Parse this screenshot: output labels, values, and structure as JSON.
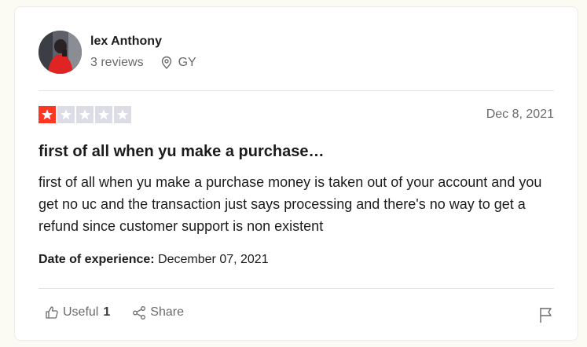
{
  "reviewer": {
    "name": "lex Anthony",
    "reviews": "3 reviews",
    "country": "GY"
  },
  "review": {
    "rating": 1,
    "max_rating": 5,
    "date": "Dec 8, 2021",
    "title": "first of all when yu make a purchase…",
    "body": "first of all when yu make a purchase money is taken out of your account and you get no uc and the transaction just says processing and there's no way to get a refund since customer support is non existent",
    "experience_label": "Date of experience:",
    "experience_date": "December 07, 2021"
  },
  "actions": {
    "useful_label": "Useful",
    "useful_count": "1",
    "share_label": "Share"
  },
  "colors": {
    "star_on": "#ff3722",
    "star_off": "#dcdce6"
  }
}
